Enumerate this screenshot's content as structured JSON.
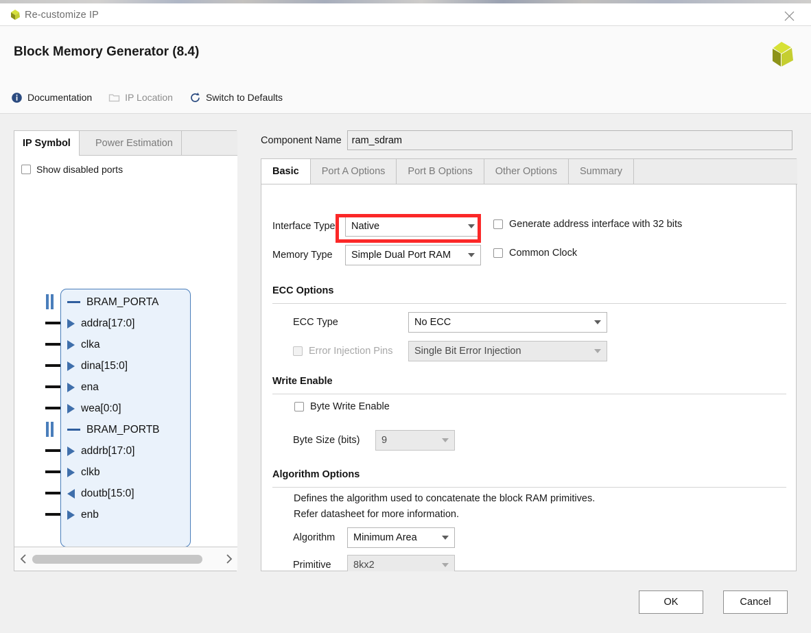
{
  "window": {
    "title": "Re-customize IP"
  },
  "header": {
    "title": "Block Memory Generator (8.4)",
    "toolbar": {
      "documentation": "Documentation",
      "ip_location": "IP Location",
      "switch_to_defaults": "Switch to Defaults"
    }
  },
  "left_panel": {
    "tabs": [
      {
        "label": "IP Symbol",
        "active": true
      },
      {
        "label": "Power Estimation",
        "active": false
      }
    ],
    "show_disabled_ports": {
      "label": "Show disabled ports",
      "checked": false
    },
    "symbol": {
      "ports": [
        {
          "name": "BRAM_PORTA",
          "kind": "bus-group"
        },
        {
          "name": "addra[17:0]",
          "kind": "input"
        },
        {
          "name": "clka",
          "kind": "input"
        },
        {
          "name": "dina[15:0]",
          "kind": "input"
        },
        {
          "name": "ena",
          "kind": "input"
        },
        {
          "name": "wea[0:0]",
          "kind": "input"
        },
        {
          "name": "BRAM_PORTB",
          "kind": "bus-group"
        },
        {
          "name": "addrb[17:0]",
          "kind": "input"
        },
        {
          "name": "clkb",
          "kind": "input"
        },
        {
          "name": "doutb[15:0]",
          "kind": "output"
        },
        {
          "name": "enb",
          "kind": "input"
        }
      ]
    }
  },
  "component_name": {
    "label": "Component Name",
    "value": "ram_sdram"
  },
  "options": {
    "tabs": [
      {
        "label": "Basic",
        "active": true
      },
      {
        "label": "Port A Options",
        "active": false
      },
      {
        "label": "Port B Options",
        "active": false
      },
      {
        "label": "Other Options",
        "active": false
      },
      {
        "label": "Summary",
        "active": false
      }
    ]
  },
  "basic": {
    "interface_type": {
      "label": "Interface Type",
      "value": "Native"
    },
    "memory_type": {
      "label": "Memory Type",
      "value": "Simple Dual Port RAM",
      "highlighted": true,
      "highlight_color": "#fb2828"
    },
    "generate_address_interface": {
      "label": "Generate address interface with 32 bits",
      "checked": false
    },
    "common_clock": {
      "label": "Common Clock",
      "checked": false
    },
    "ecc_options": {
      "title": "ECC Options",
      "ecc_type": {
        "label": "ECC Type",
        "value": "No ECC"
      },
      "error_injection_pins": {
        "label": "Error Injection Pins",
        "checked": false,
        "disabled": true,
        "value": "Single Bit Error Injection"
      }
    },
    "write_enable": {
      "title": "Write Enable",
      "byte_write_enable": {
        "label": "Byte Write Enable",
        "checked": false
      },
      "byte_size": {
        "label": "Byte Size (bits)",
        "value": "9",
        "disabled": true
      }
    },
    "algorithm_options": {
      "title": "Algorithm Options",
      "description_line1": "Defines the algorithm used to concatenate the block RAM primitives.",
      "description_line2": "Refer datasheet for more information.",
      "algorithm": {
        "label": "Algorithm",
        "value": "Minimum Area"
      },
      "primitive": {
        "label": "Primitive",
        "value": "8kx2",
        "disabled": true
      }
    }
  },
  "footer": {
    "ok": "OK",
    "cancel": "Cancel"
  }
}
